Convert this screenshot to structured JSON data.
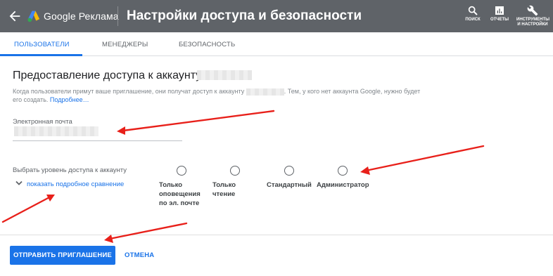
{
  "header": {
    "brand": "Google Реклама",
    "title": "Настройки доступа и безопасности",
    "actions": [
      {
        "label": "ПОИСК",
        "icon": "search-icon"
      },
      {
        "label": "ОТЧЕТЫ",
        "icon": "reports-icon"
      },
      {
        "label": "ИНСТРУМЕНТЫ И НАСТРОЙКИ",
        "icon": "wrench-icon"
      }
    ]
  },
  "tabs": [
    {
      "label": "ПОЛЬЗОВАТЕЛИ",
      "active": true
    },
    {
      "label": "МЕНЕДЖЕРЫ",
      "active": false
    },
    {
      "label": "БЕЗОПАСНОСТЬ",
      "active": false
    }
  ],
  "card": {
    "title": "Предоставление доступа к аккаунту",
    "desc_before": "Когда пользователи примут ваше приглашение, они получат доступ к аккаунту",
    "desc_after": ". Тем, у кого нет аккаунта Google, нужно будет его создать.",
    "more_link": "Подробнее…",
    "email_label": "Электронная почта",
    "level_label": "Выбрать уровень доступа к аккаунту",
    "compare_link": "показать подробное сравнение",
    "options": [
      "Только оповещения по эл. почте",
      "Только чтение",
      "Стандартный",
      "Администратор"
    ]
  },
  "footer": {
    "send_label": "ОТПРАВИТЬ ПРИГЛАШЕНИЕ",
    "cancel_label": "ОТМЕНА"
  },
  "colors": {
    "header_bg": "#5f6368",
    "accent": "#1a73e8",
    "annotation_arrow": "#e8201a"
  }
}
